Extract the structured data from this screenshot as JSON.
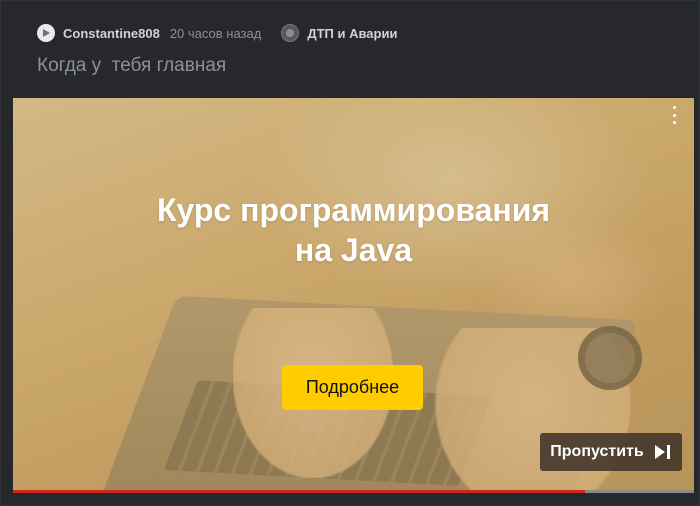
{
  "post": {
    "author": "Constantine808",
    "time": "20 часов назад",
    "community": "ДТП и Аварии",
    "title": "Когда у  тебя главная"
  },
  "ad": {
    "headline_line1": "Курс программирования",
    "headline_line2": "на Java",
    "cta_label": "Подробнее",
    "skip_label": "Пропустить",
    "cta_color": "#ffcc00",
    "progress": 0.84
  },
  "icons": {
    "avatar": "play-icon",
    "community": "community-icon",
    "menu": "kebab-menu-icon",
    "skip": "skip-next-icon"
  }
}
